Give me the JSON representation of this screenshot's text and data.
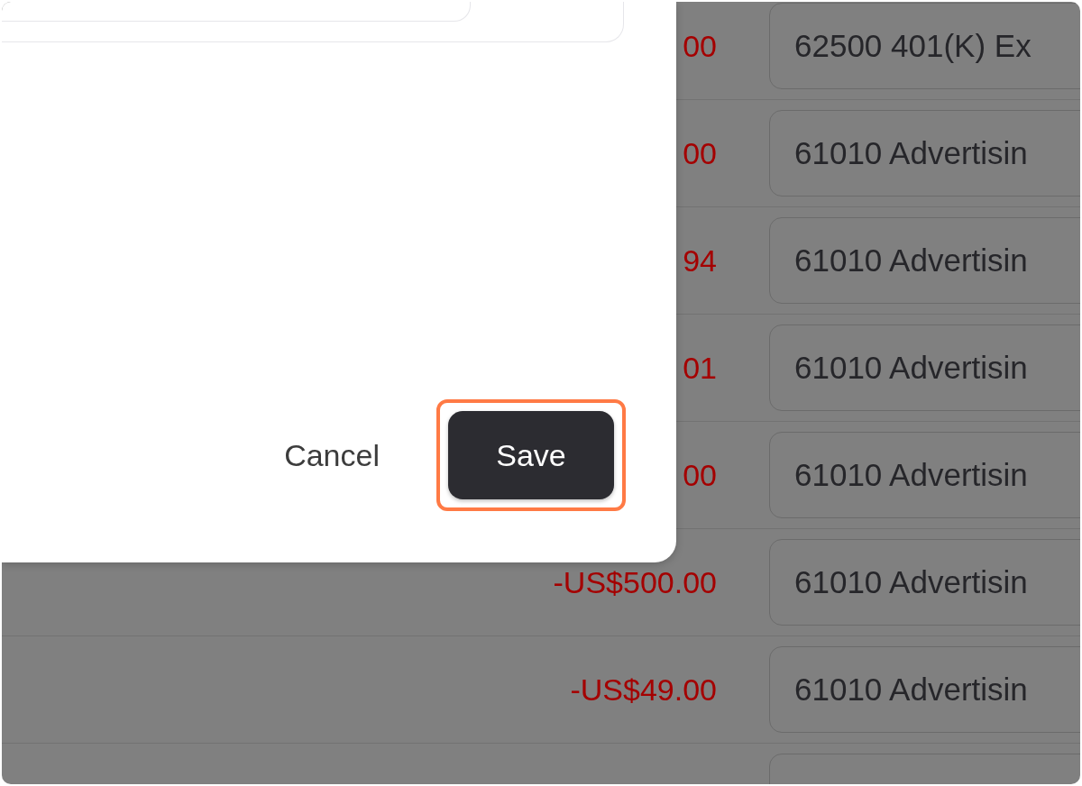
{
  "dialog": {
    "buttons": [
      {
        "label": "Cancel",
        "kind": "secondary",
        "highlighted": false
      },
      {
        "label": "Save",
        "kind": "primary",
        "highlighted": true
      }
    ]
  },
  "rows": [
    {
      "amount": "00",
      "account": "62500 401(K) Ex"
    },
    {
      "amount": "00",
      "account": "61010 Advertisin"
    },
    {
      "amount": "94",
      "account": "61010 Advertisin"
    },
    {
      "amount": "01",
      "account": "61010 Advertisin"
    },
    {
      "amount": "00",
      "account": "61010 Advertisin"
    },
    {
      "amount": "-US$500.00",
      "account": "61010 Advertisin"
    },
    {
      "amount": "-US$49.00",
      "account": "61010 Advertisin"
    }
  ],
  "next_row_partial": true
}
